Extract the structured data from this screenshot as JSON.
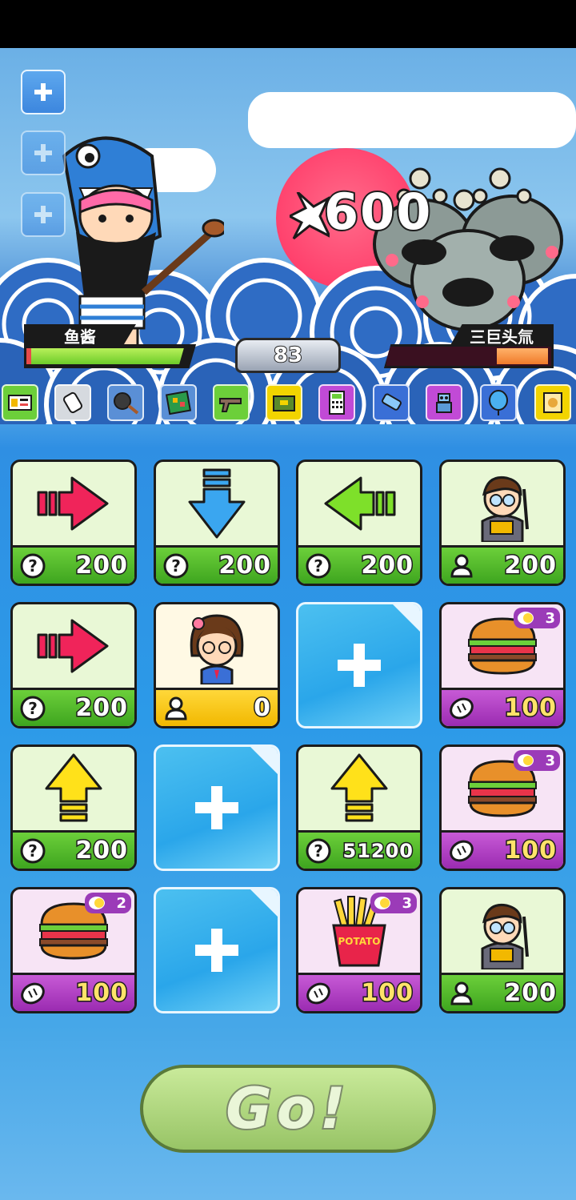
{
  "player": {
    "name": "鱼酱",
    "hp_fraction": 0.94
  },
  "enemy": {
    "name": "三巨头氚",
    "hp_fraction": 0.31
  },
  "damage_number": "600",
  "turn_counter": "83",
  "add_slots": 3,
  "inventory_strip": [
    "ticket-icon",
    "cylinder-icon",
    "pan-icon",
    "circuit-board-icon",
    "gun-icon",
    "ammo-box-icon",
    "calculator-icon",
    "battery-icon",
    "robot-icon",
    "balloon-icon",
    "scroll-icon"
  ],
  "colors": {
    "player_hp": "#6ccc2a",
    "enemy_hp": "#f07a2a",
    "go_button": "#b8dd86"
  },
  "cards": [
    {
      "type": "arrow-right",
      "price": "200",
      "currency": "question"
    },
    {
      "type": "arrow-down",
      "price": "200",
      "currency": "question"
    },
    {
      "type": "arrow-left",
      "price": "200",
      "currency": "question"
    },
    {
      "type": "teacher",
      "price": "200",
      "currency": "person"
    },
    {
      "type": "arrow-right",
      "price": "200",
      "currency": "question"
    },
    {
      "type": "girl",
      "price": "0",
      "currency": "person"
    },
    {
      "type": "empty"
    },
    {
      "type": "burger",
      "price": "100",
      "currency": "bread",
      "badge": "3"
    },
    {
      "type": "arrow-up",
      "price": "200",
      "currency": "question"
    },
    {
      "type": "empty"
    },
    {
      "type": "arrow-up",
      "price": "51200",
      "currency": "question"
    },
    {
      "type": "burger",
      "price": "100",
      "currency": "bread",
      "badge": "3"
    },
    {
      "type": "burger",
      "price": "100",
      "currency": "bread",
      "badge": "2"
    },
    {
      "type": "empty"
    },
    {
      "type": "fries",
      "price": "100",
      "currency": "bread",
      "badge": "3",
      "fries_label": "POTATO"
    },
    {
      "type": "teacher",
      "price": "200",
      "currency": "person"
    }
  ],
  "go_button": {
    "label": "Go!"
  }
}
